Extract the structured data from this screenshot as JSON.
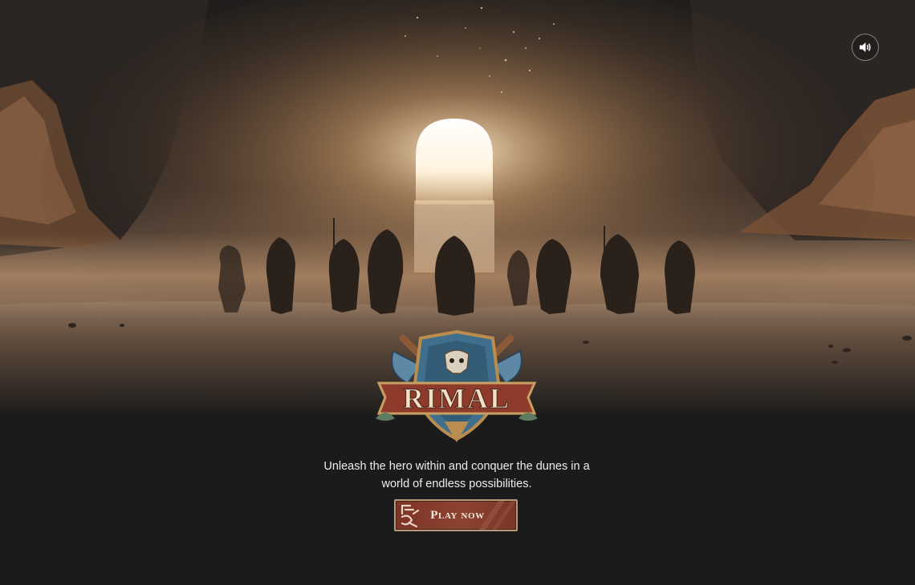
{
  "hero": {
    "title": "RIMAL",
    "tagline": "Unleash the hero within and conquer the dunes in a world of endless possibilities."
  },
  "actions": {
    "play_label": "Play now"
  },
  "controls": {
    "sound_icon": "volume-on-icon"
  },
  "colors": {
    "background": "#1b1b1b",
    "sand": "#8a6a4e",
    "portal_glow": "#fff6e2",
    "button_fill": "#8d4331",
    "button_border": "#b9987a",
    "logo_blue": "#3f6f8c",
    "logo_red": "#8f3b2b"
  }
}
